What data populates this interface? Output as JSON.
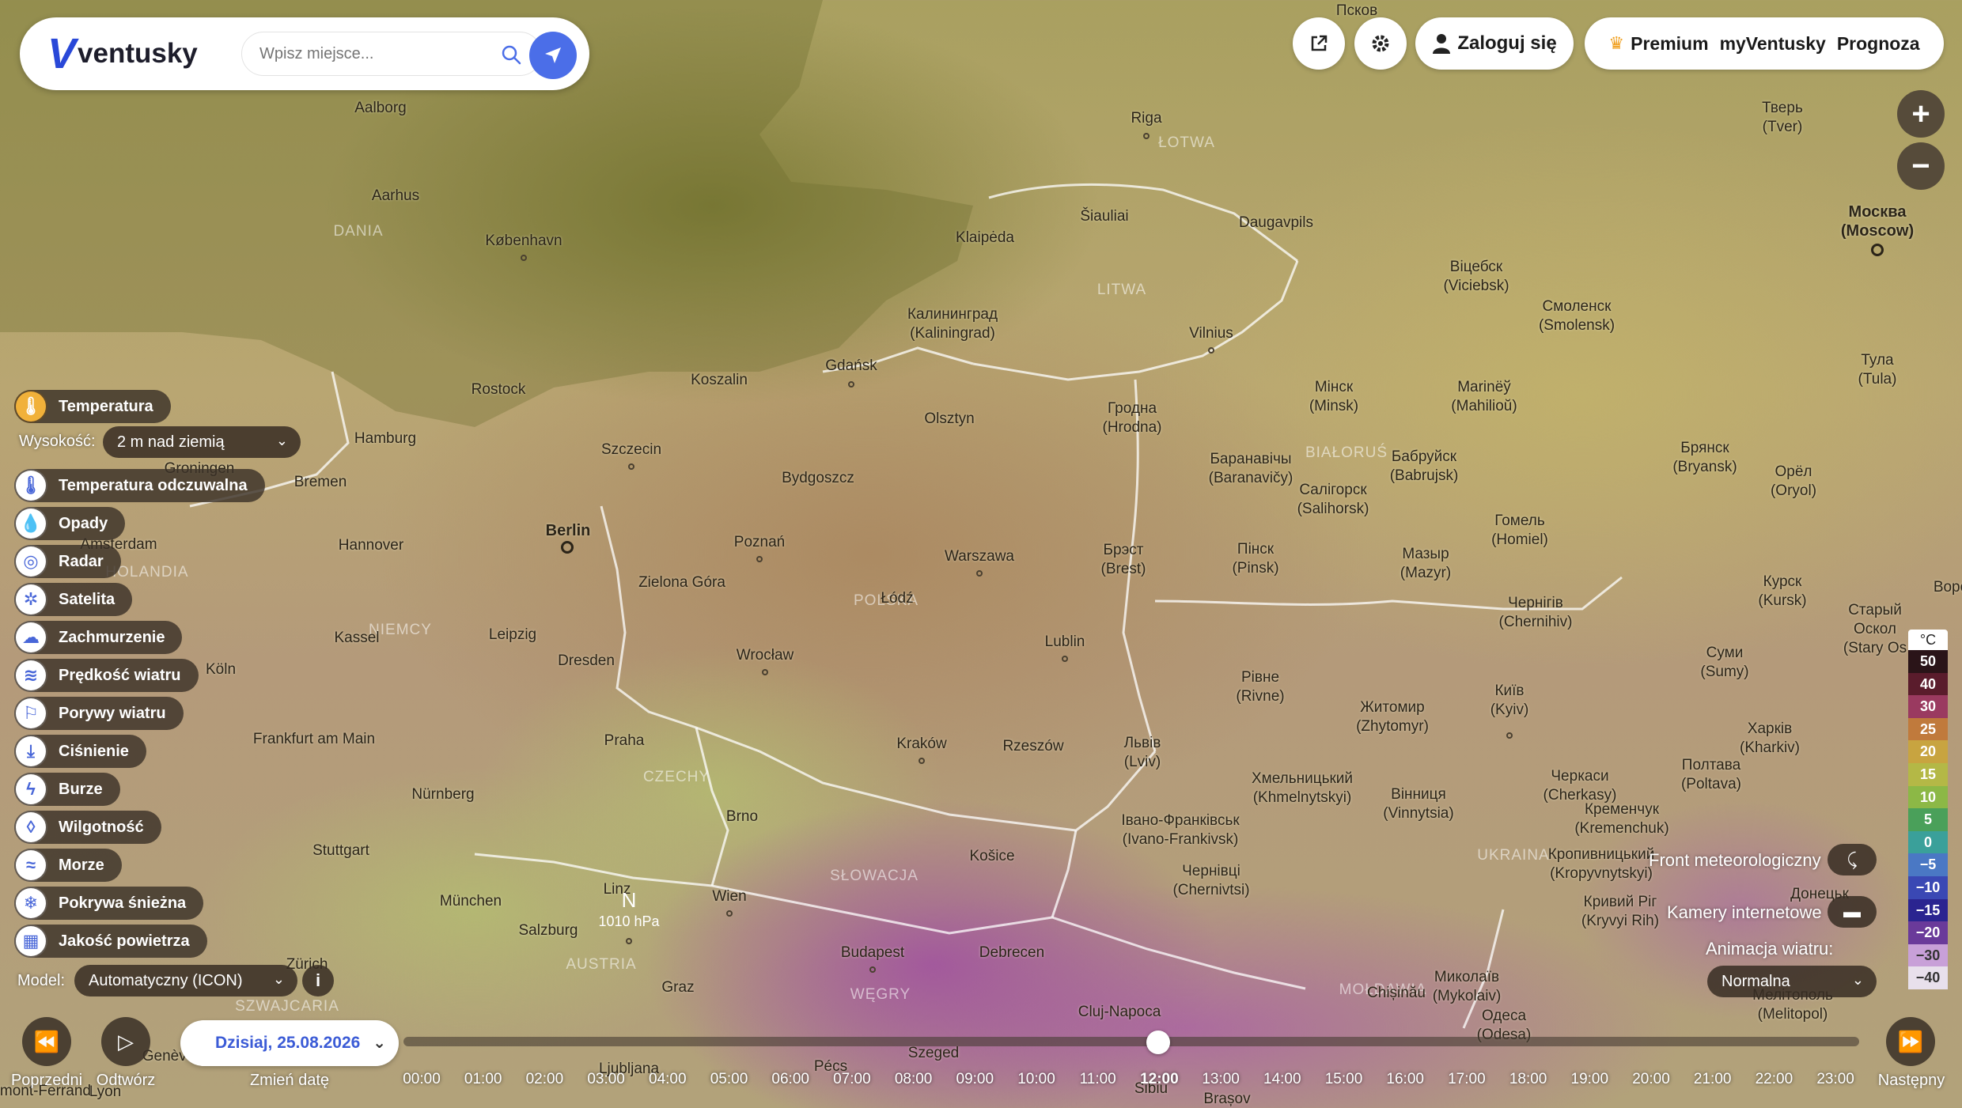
{
  "app": {
    "logo_mark": "V",
    "logo_text": "ventusky"
  },
  "search": {
    "placeholder": "Wpisz miejsce..."
  },
  "header": {
    "login_label": "Zaloguj się",
    "premium_label": "Premium",
    "myventusky_label": "myVentusky",
    "prognoza_label": "Prognoza"
  },
  "zoom": {
    "in": "+",
    "out": "−"
  },
  "layers": {
    "active": "Temperatura",
    "height_label": "Wysokość:",
    "height_value": "2 m nad ziemią",
    "items": [
      "Temperatura odczuwalna",
      "Opady",
      "Radar",
      "Satelita",
      "Zachmurzenie",
      "Prędkość wiatru",
      "Porywy wiatru",
      "Ciśnienie",
      "Burze",
      "Wilgotność",
      "Morze",
      "Pokrywa śnieżna",
      "Jakość powietrza"
    ],
    "model_label": "Model:",
    "model_value": "Automatyczny (ICON)",
    "info": "i"
  },
  "overlays": {
    "front_label": "Front meteorologiczny",
    "cameras_label": "Kamery internetowe",
    "animation_label": "Animacja wiatru:",
    "animation_value": "Normalna"
  },
  "legend": {
    "unit": "°C",
    "values": [
      "50",
      "40",
      "30",
      "25",
      "20",
      "15",
      "10",
      "5",
      "0",
      "−5",
      "−10",
      "−15",
      "−20",
      "−30",
      "−40"
    ],
    "colors": [
      "#2a1418",
      "#5a1c2c",
      "#9a3a60",
      "#c07a3c",
      "#c8a440",
      "#b4b846",
      "#8cb846",
      "#4aa05a",
      "#3aa09a",
      "#4a78c4",
      "#3a48b4",
      "#2a2490",
      "#6a3a9a",
      "#c8a0d8",
      "#e8e0ec"
    ]
  },
  "timeline": {
    "prev_label": "Poprzedni",
    "play_label": "Odtwórz",
    "change_date_label": "Zmień datę",
    "next_label": "Następny",
    "date": "Dzisiaj, 25.08.2026",
    "hours": [
      "00:00",
      "01:00",
      "02:00",
      "03:00",
      "04:00",
      "05:00",
      "06:00",
      "07:00",
      "08:00",
      "09:00",
      "10:00",
      "11:00",
      "12:00",
      "13:00",
      "14:00",
      "15:00",
      "16:00",
      "17:00",
      "18:00",
      "19:00",
      "20:00",
      "21:00",
      "22:00",
      "23:00"
    ],
    "current_hour": "12:00"
  },
  "map": {
    "pressure_label": "N",
    "pressure_value": "1010 hPa",
    "countries": [
      "ŁOTWA",
      "LITWA",
      "DANIA",
      "BIAŁORUŚ",
      "POLSKA",
      "NIEMCY",
      "CZECHY",
      "SŁOWACJA",
      "AUSTRIA",
      "WĘGRY",
      "UKRAINA",
      "MOŁDAWIA",
      "SZWAJCARIA",
      "HOLANDIA"
    ],
    "cities": [
      "Псков",
      "Riga",
      "Aalborg",
      "Aarhus",
      "København",
      "Klaipėda",
      "Šiauliai",
      "Daugavpils",
      "Тверь\n(Tver)",
      "Москва\n(Moscow)",
      "Калининград\n(Kaliningrad)",
      "Vilnius",
      "Віцебск\n(Viciebsk)",
      "Смоленск\n(Smolensk)",
      "Тула\n(Tula)",
      "Rostock",
      "Koszalin",
      "Gdańsk",
      "Olsztyn",
      "Гродна\n(Hrodna)",
      "Мінск\n(Minsk)",
      "Marinёў\n(Mahilioŭ)",
      "Hamburg",
      "Szczecin",
      "Bydgoszcz",
      "Bremen",
      "Баранавічы\n(Baranavičy)",
      "Бабруйск\n(Babrujsk)",
      "Салігорск\n(Salihorsk)",
      "Брянск\n(Bryansk)",
      "Орёл\n(Oryol)",
      "Berlin",
      "Poznań",
      "Warszawa",
      "Hannover",
      "Брэст\n(Brest)",
      "Пінск\n(Pinsk)",
      "Мазыр\n(Mazyr)",
      "Гомель\n(Homiel)",
      "Zielona Góra",
      "Łódź",
      "Курск\n(Kursk)",
      "Чернігів\n(Chernihiv)",
      "Kassel",
      "Leipzig",
      "Dresden",
      "Lublin",
      "Wrocław",
      "Köln",
      "Старый Оскол\n(Stary Os",
      "Суми\n(Sumy)",
      "Рівне\n(Rivne)",
      "Житомир\n(Zhytomyr)",
      "Київ\n(Kyiv)",
      "Frankfurt am Main",
      "Praha",
      "Kraków",
      "Rzeszów",
      "Львів\n(Lviv)",
      "Харків\n(Kharkiv)",
      "Nürnberg",
      "Хмельницький\n(Khmelnytskyi)",
      "Вінниця\n(Vinnytsia)",
      "Черкаси\n(Cherkasy)",
      "Полтава\n(Poltava)",
      "Brno",
      "Івано-Франківськ\n(Ivano-Frankivsk)",
      "Кременчук\n(Kremenchuk)",
      "Stuttgart",
      "Košice",
      "Кропивницький\n(Kropyvnytskyi)",
      "Linz",
      "München",
      "Wien",
      "Чернівці\n(Chernivtsi)",
      "Кривий Ріг\n(Kryvyi Rih)",
      "Salzburg",
      "Budapest",
      "Debrecen",
      "Миколаїв\n(Mykolaiv)",
      "Zürich",
      "Graz",
      "Cluj-Napoca",
      "Одеса\n(Odesa)",
      "Chișinău",
      "Мелітополь\n(Melitopol)",
      "Szeged",
      "Pécs",
      "Ljubljana",
      "Sibiu",
      "Brașov",
      "Lyon",
      "Genève",
      "Донецьк",
      "Воро",
      "Groningen",
      "Amsterdam",
      "Clermont-Ferrand"
    ]
  }
}
